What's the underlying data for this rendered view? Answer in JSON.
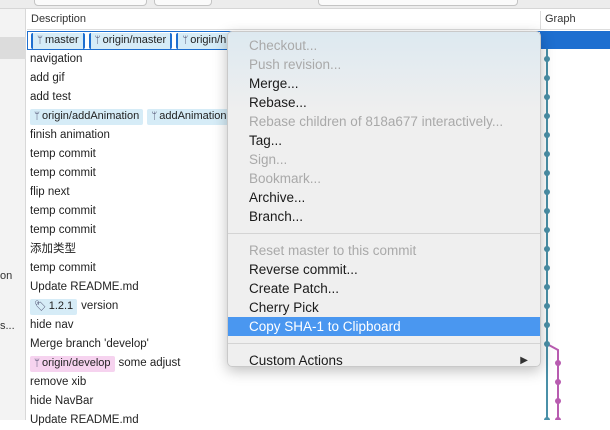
{
  "sidebar": {
    "items": [
      "on",
      "s..."
    ]
  },
  "header": {
    "description": "Description",
    "graph": "Graph"
  },
  "rows": [
    {
      "tags": [
        {
          "label": "master",
          "icon": "branch-icon"
        },
        {
          "label": "origin/master",
          "icon": "branch-icon"
        },
        {
          "label": "origin/h",
          "icon": "branch-icon"
        }
      ],
      "text": ""
    },
    {
      "text": "navigation"
    },
    {
      "text": "add gif"
    },
    {
      "text": "add test"
    },
    {
      "tags": [
        {
          "label": "origin/addAnimation",
          "icon": "branch-icon"
        },
        {
          "label": "addAnimation",
          "icon": "branch-icon"
        }
      ],
      "text": ""
    },
    {
      "text": "finish animation"
    },
    {
      "text": "temp commit"
    },
    {
      "text": "temp commit"
    },
    {
      "text": "flip next"
    },
    {
      "text": "temp commit"
    },
    {
      "text": "temp commit"
    },
    {
      "text": "添加类型"
    },
    {
      "text": "temp commit"
    },
    {
      "text": "Update README.md"
    },
    {
      "tags": [
        {
          "label": "1.2.1",
          "icon": "tag-icon"
        }
      ],
      "text": "version"
    },
    {
      "text": "hide nav"
    },
    {
      "text": "Merge branch 'develop'"
    },
    {
      "tags": [
        {
          "label": "origin/develop",
          "icon": "branch-icon",
          "color": "pink"
        }
      ],
      "text": "some adjust"
    },
    {
      "text": "remove xib"
    },
    {
      "text": "hide NavBar"
    },
    {
      "text": "Update README.md"
    }
  ],
  "menu": {
    "items": [
      {
        "label": "Checkout...",
        "disabled": true
      },
      {
        "label": "Push revision...",
        "disabled": true
      },
      {
        "label": "Merge..."
      },
      {
        "label": "Rebase..."
      },
      {
        "label": "Rebase children of 818a677 interactively...",
        "disabled": true
      },
      {
        "label": "Tag..."
      },
      {
        "label": "Sign...",
        "disabled": true
      },
      {
        "label": "Bookmark...",
        "disabled": true
      },
      {
        "label": "Archive..."
      },
      {
        "label": "Branch..."
      },
      {
        "sep": true
      },
      {
        "label": "Reset master to this commit",
        "disabled": true
      },
      {
        "label": "Reverse commit..."
      },
      {
        "label": "Create Patch..."
      },
      {
        "label": "Cherry Pick"
      },
      {
        "label": "Copy SHA-1 to Clipboard",
        "highlighted": true
      },
      {
        "sep": true
      },
      {
        "label": "Custom Actions",
        "submenu": true
      }
    ]
  },
  "colors": {
    "accent": "#1e6fd0",
    "graph_main": "#4a90a8",
    "graph_branch": "#b85cb0",
    "highlight": "#4a97f0"
  }
}
